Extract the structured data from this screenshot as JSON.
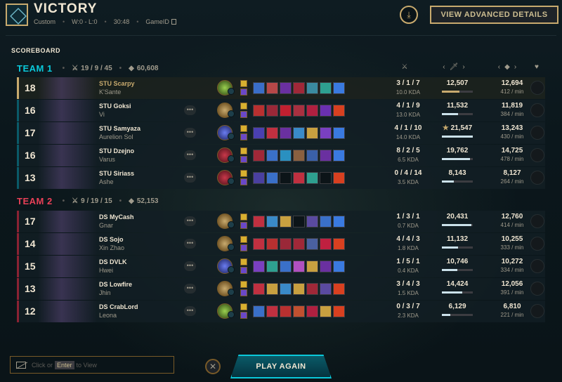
{
  "header": {
    "title": "VICTORY",
    "queue": "Custom",
    "record": "W:0 - L:0",
    "duration": "30:48",
    "game_id_label": "GameID",
    "advanced_button": "VIEW ADVANCED DETAILS"
  },
  "scoreboard_label": "SCOREBOARD",
  "teams": [
    {
      "name": "TEAM 1",
      "kda": "19 / 9 / 45",
      "gold": "60,608",
      "players": [
        {
          "level": "18",
          "name": "STU Scarpy",
          "champion": "K'Sante",
          "keystone": "res",
          "kda": "3 / 1 / 7",
          "kda_ratio": "10.0 KDA",
          "damage": "12,507",
          "damage_frac": 0.57,
          "gold": "12,694",
          "gpm": "412 / min",
          "items": [
            "#3a6ec8",
            "#b84848",
            "#6a30a0",
            "#a02838",
            "#3a8aa0",
            "#2ea090",
            "#3a7ae0"
          ],
          "me": true,
          "more": false
        },
        {
          "level": "16",
          "name": "STU Goksi",
          "champion": "Vi",
          "keystone": "prec",
          "kda": "4 / 1 / 9",
          "kda_ratio": "13.0 KDA",
          "damage": "11,532",
          "damage_frac": 0.53,
          "gold": "11,819",
          "gpm": "384 / min",
          "items": [
            "#b83030",
            "#9a2838",
            "#c02030",
            "#a83040",
            "#b02040",
            "#6a30b0",
            "#d84020"
          ],
          "me": false,
          "more": true
        },
        {
          "level": "17",
          "name": "STU Samyaza",
          "champion": "Aurelion Sol",
          "keystone": "sorc",
          "kda": "4 / 1 / 10",
          "kda_ratio": "14.0 KDA",
          "damage": "21,547",
          "damage_frac": 1.0,
          "gold": "13,243",
          "gpm": "430 / min",
          "items": [
            "#4a40b0",
            "#c03040",
            "#6a30a0",
            "#3a8ac8",
            "#c8a040",
            "#7a40c0",
            "#3a7ae0"
          ],
          "me": false,
          "more": true,
          "best_damage": true
        },
        {
          "level": "16",
          "name": "STU Dzejno",
          "champion": "Varus",
          "keystone": "dom",
          "kda": "8 / 2 / 5",
          "kda_ratio": "6.5 KDA",
          "damage": "19,762",
          "damage_frac": 0.92,
          "gold": "14,725",
          "gpm": "478 / min",
          "items": [
            "#a02838",
            "#3a70c8",
            "#2a90c0",
            "#8a6040",
            "#3a60a8",
            "#6a30a0",
            "#3a7ae0"
          ],
          "me": false,
          "more": true
        },
        {
          "level": "13",
          "name": "STU Siriass",
          "champion": "Ashe",
          "keystone": "dom",
          "kda": "0 / 4 / 14",
          "kda_ratio": "3.5 KDA",
          "damage": "8,143",
          "damage_frac": 0.38,
          "gold": "8,127",
          "gpm": "264 / min",
          "items": [
            "#4a40a0",
            "#3a70c8",
            "",
            "#c03040",
            "#2ea090",
            "",
            "#d84020"
          ],
          "me": false,
          "more": true
        }
      ]
    },
    {
      "name": "TEAM 2",
      "kda": "9 / 19 / 15",
      "gold": "52,153",
      "players": [
        {
          "level": "17",
          "name": "DS MyCash",
          "champion": "Gnar",
          "keystone": "prec",
          "kda": "1 / 3 / 1",
          "kda_ratio": "0.7 KDA",
          "damage": "20,431",
          "damage_frac": 0.95,
          "gold": "12,760",
          "gpm": "414 / min",
          "items": [
            "#c03040",
            "#3a8ac8",
            "#c8a040",
            "",
            "#5a4aa0",
            "#3a70c8",
            "#3a7ae0"
          ],
          "me": false,
          "more": true
        },
        {
          "level": "14",
          "name": "DS Sojo",
          "champion": "Xin Zhao",
          "keystone": "prec",
          "kda": "4 / 4 / 3",
          "kda_ratio": "1.8 KDA",
          "damage": "11,132",
          "damage_frac": 0.52,
          "gold": "10,255",
          "gpm": "333 / min",
          "items": [
            "#c03040",
            "#b83030",
            "#9a2838",
            "#a02838",
            "#4a60a0",
            "#c02040",
            "#d84020"
          ],
          "me": false,
          "more": true
        },
        {
          "level": "15",
          "name": "DS DVLK",
          "champion": "Hwei",
          "keystone": "sorc",
          "kda": "1 / 5 / 1",
          "kda_ratio": "0.4 KDA",
          "damage": "10,746",
          "damage_frac": 0.5,
          "gold": "10,272",
          "gpm": "334 / min",
          "items": [
            "#7a40c0",
            "#2ea090",
            "#3a70c8",
            "#b050c0",
            "#c8a040",
            "#6a30a0",
            "#3a7ae0"
          ],
          "me": false,
          "more": true
        },
        {
          "level": "13",
          "name": "DS Lowfire",
          "champion": "Jhin",
          "keystone": "prec",
          "kda": "3 / 4 / 3",
          "kda_ratio": "1.5 KDA",
          "damage": "14,424",
          "damage_frac": 0.67,
          "gold": "12,056",
          "gpm": "391 / min",
          "items": [
            "#c03040",
            "#c8a040",
            "#3a8ac8",
            "#c8a040",
            "#a02838",
            "#5a4aa0",
            "#d84020"
          ],
          "me": false,
          "more": true
        },
        {
          "level": "12",
          "name": "DS CrabLord",
          "champion": "Leona",
          "keystone": "res",
          "kda": "0 / 3 / 7",
          "kda_ratio": "2.3 KDA",
          "damage": "6,129",
          "damage_frac": 0.28,
          "gold": "6,810",
          "gpm": "221 / min",
          "items": [
            "#3a70c8",
            "#c03040",
            "#b83030",
            "#c05030",
            "#b02040",
            "#c8a040",
            "#d84020"
          ],
          "me": false,
          "more": true
        }
      ]
    }
  ],
  "footer": {
    "chat_before": "Click or",
    "chat_key": "Enter",
    "chat_after": "to View",
    "play_again": "PLAY AGAIN"
  }
}
